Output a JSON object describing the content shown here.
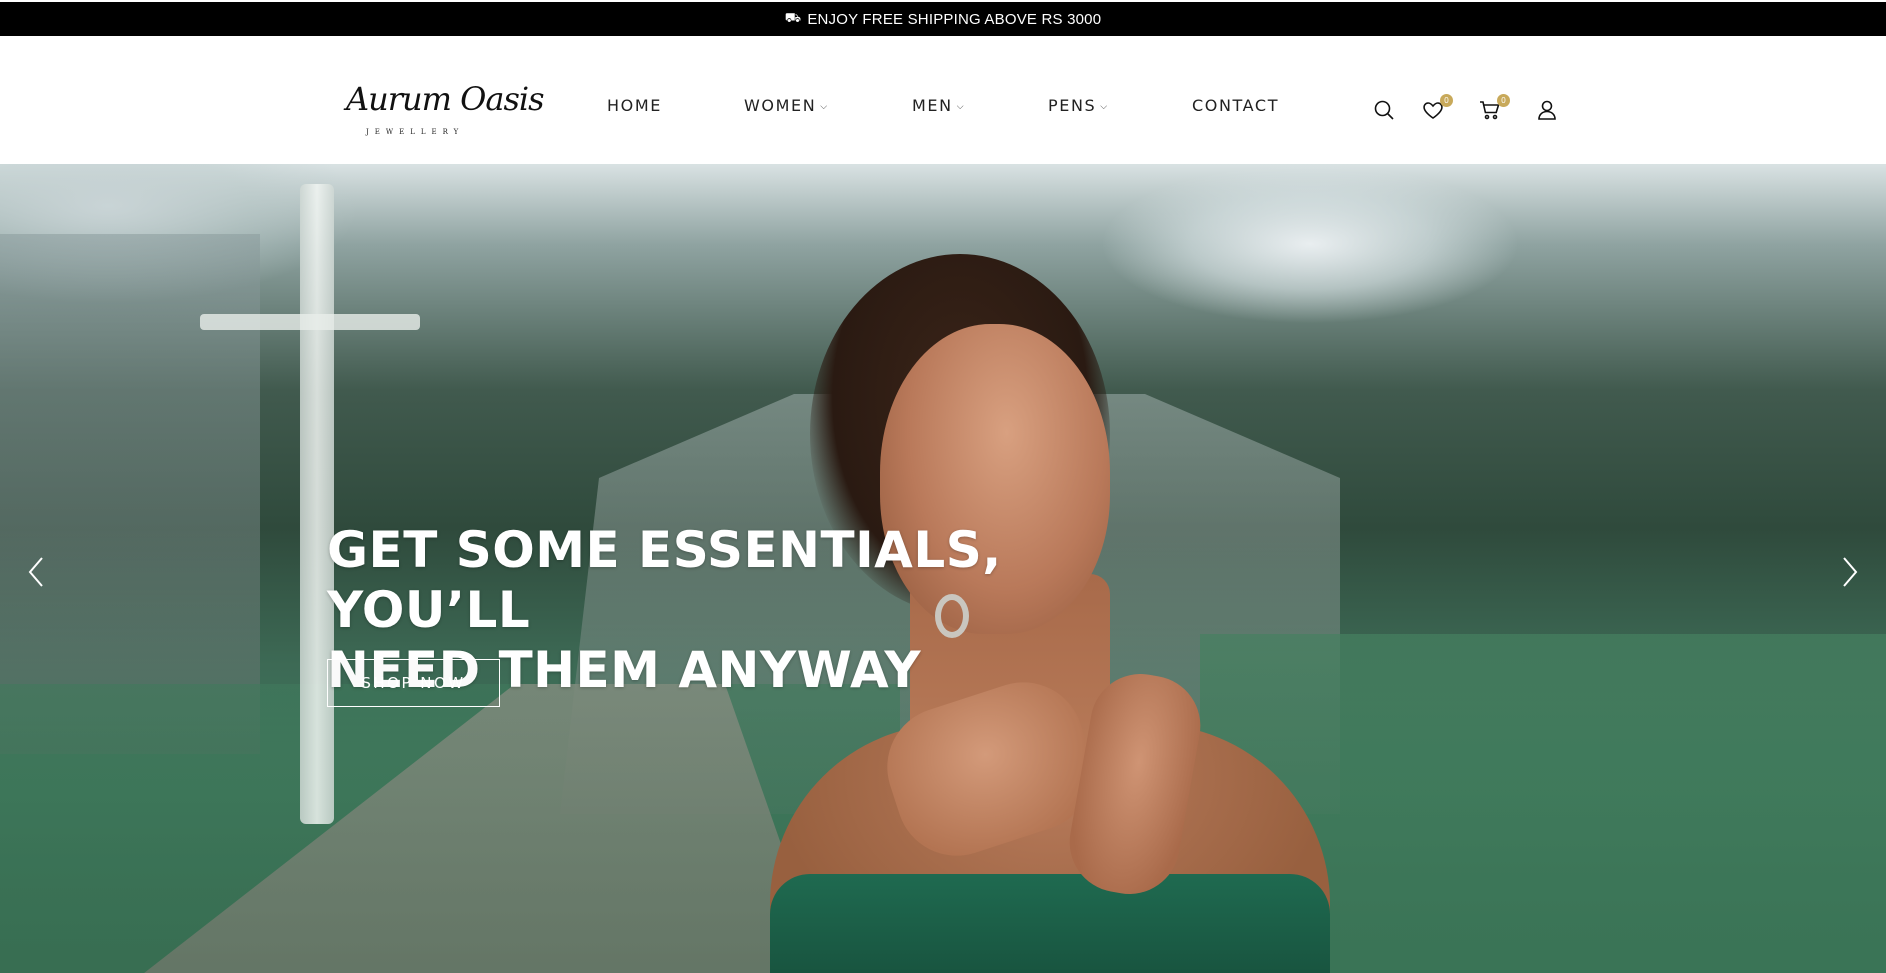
{
  "announcement": {
    "icon": "truck-icon",
    "text": "ENJOY FREE SHIPPING ABOVE RS 3000"
  },
  "brand": {
    "logo_script": "Aurum Oasis",
    "logo_sub": "JEWELLERY"
  },
  "nav": {
    "items": [
      {
        "label": "HOME",
        "dropdown": false
      },
      {
        "label": "WOMEN",
        "dropdown": true
      },
      {
        "label": "MEN",
        "dropdown": true
      },
      {
        "label": "PENS",
        "dropdown": true
      },
      {
        "label": "CONTACT",
        "dropdown": false
      }
    ]
  },
  "header_icons": {
    "search": "search-icon",
    "wishlist": {
      "icon": "heart-icon",
      "count": "0"
    },
    "cart": {
      "icon": "cart-icon",
      "count": "0"
    },
    "account": "user-icon",
    "badge_color": "#c8a95a"
  },
  "hero": {
    "title_line1": "GET SOME ESSENTIALS, YOU’LL",
    "title_line2": "NEED THEM ANYWAY",
    "cta_label": "SHOP NOW",
    "prev_icon": "chevron-left-icon",
    "next_icon": "chevron-right-icon"
  }
}
